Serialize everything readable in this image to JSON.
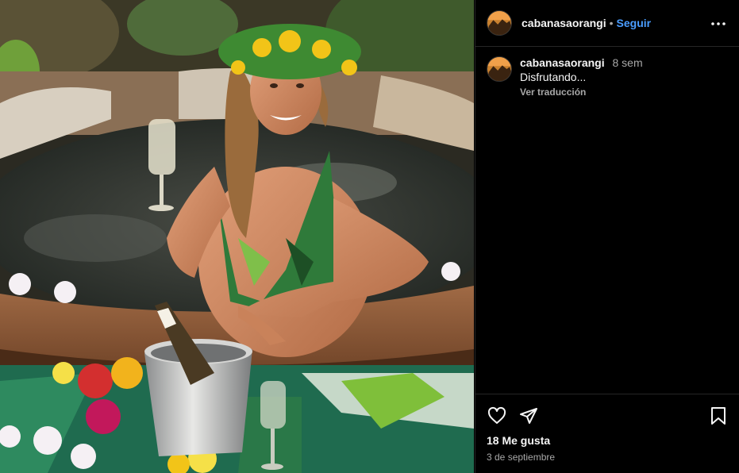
{
  "post": {
    "username": "cabanasaorangi",
    "follow_label": "Seguir",
    "separator": "•",
    "caption_username": "cabanasaorangi",
    "caption_age": "8 sem",
    "caption_text": "Disfrutando...",
    "translate_label": "Ver traducción",
    "likes": "18 Me gusta",
    "date": "3 de septiembre"
  },
  "colors": {
    "accent": "#4a9dff",
    "background": "#000000",
    "muted": "#a8a8a8"
  }
}
